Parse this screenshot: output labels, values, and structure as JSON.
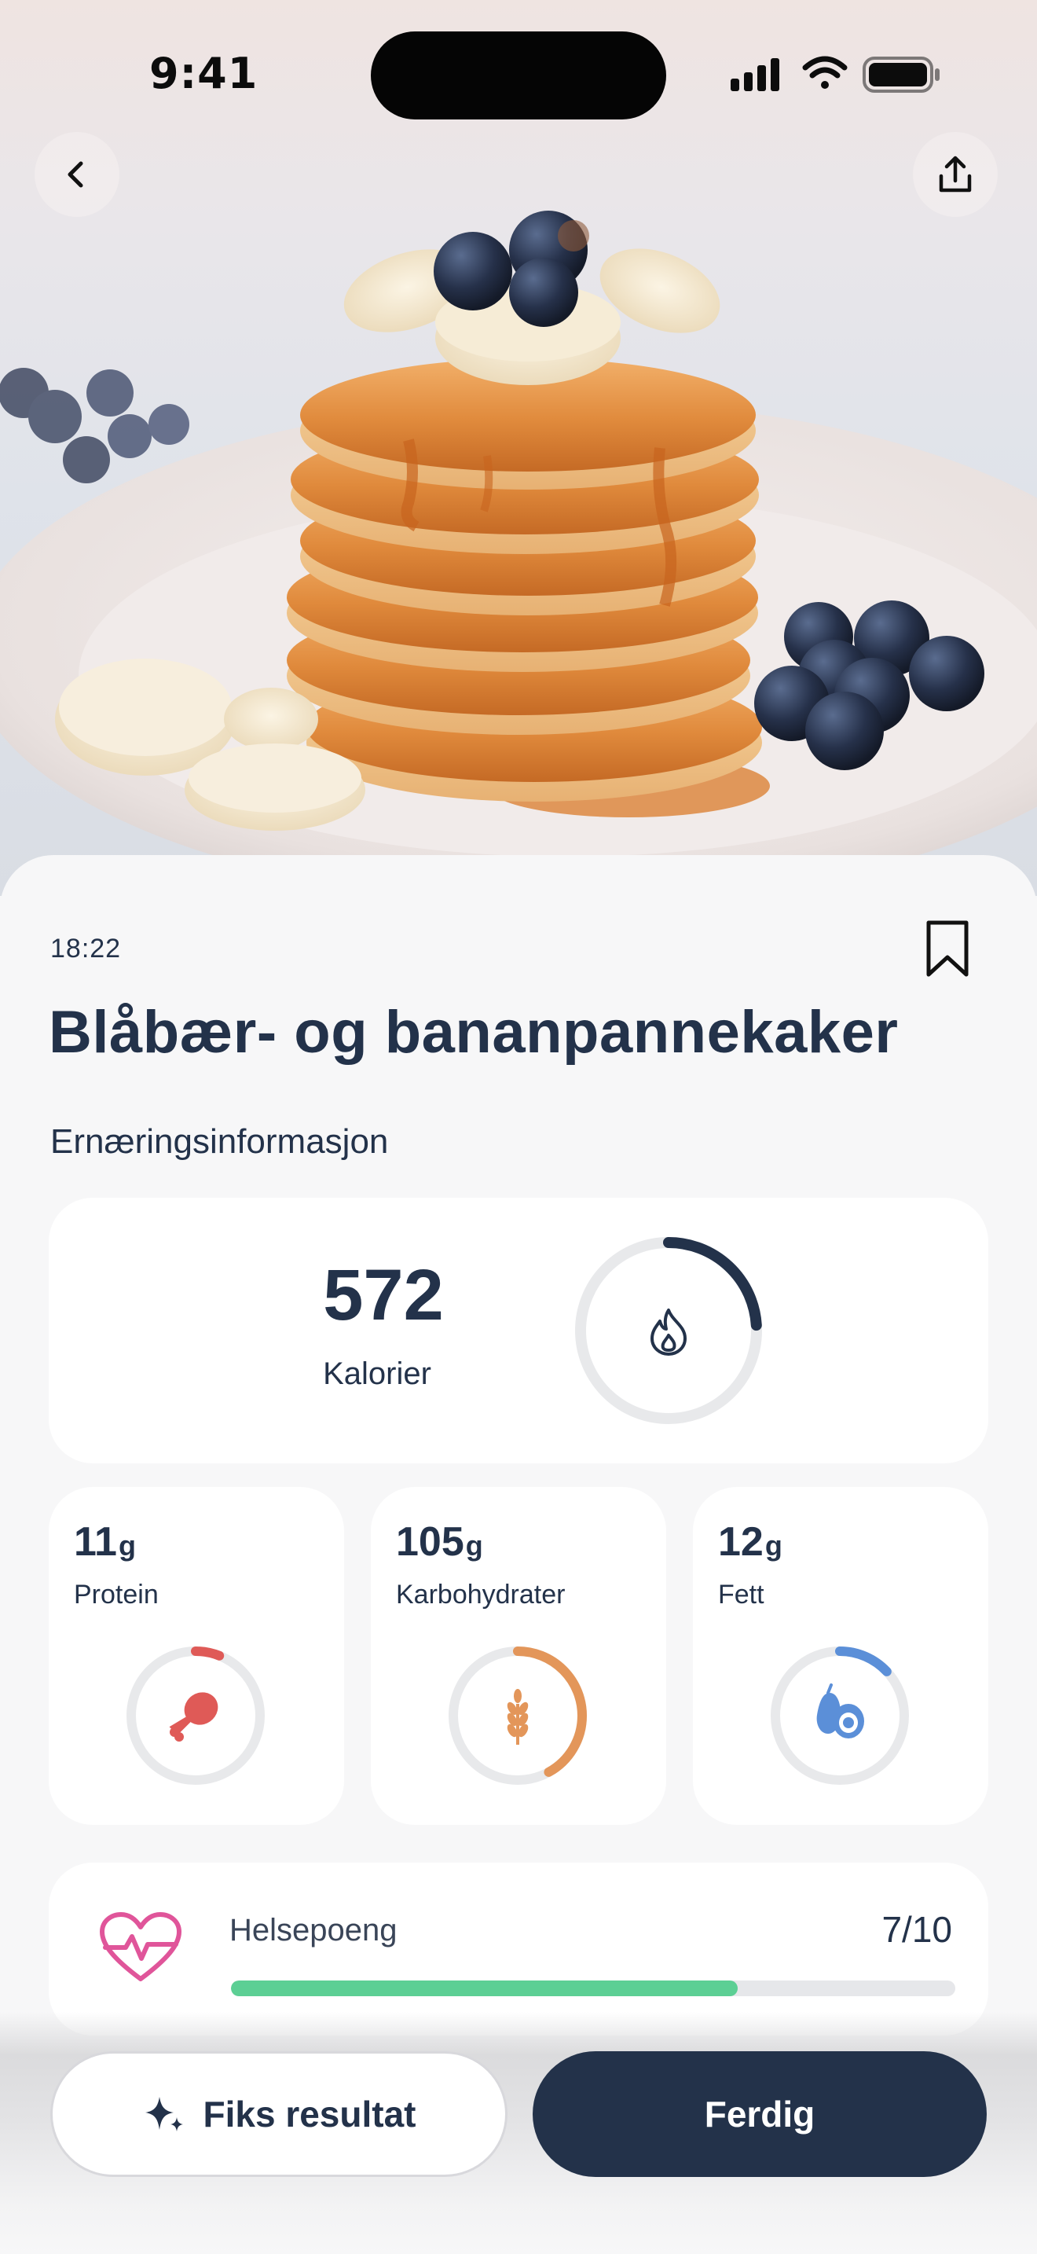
{
  "status_bar": {
    "time": "9:41"
  },
  "meal": {
    "time": "18:22",
    "title": "Blåbær- og bananpannekaker"
  },
  "nutrition": {
    "heading": "Ernæringsinformasjon",
    "calories": {
      "value": "572",
      "label": "Kalorier",
      "progress": 0.24,
      "color": "#23324a",
      "icon": "flame-icon"
    },
    "macros": [
      {
        "key": "protein",
        "value": "11",
        "unit": "g",
        "label": "Protein",
        "progress": 0.06,
        "color": "#df5a57",
        "icon": "drumstick-icon"
      },
      {
        "key": "carbs",
        "value": "105",
        "unit": "g",
        "label": "Karbohydrater",
        "progress": 0.42,
        "color": "#e3965a",
        "icon": "wheat-icon"
      },
      {
        "key": "fat",
        "value": "12",
        "unit": "g",
        "label": "Fett",
        "progress": 0.13,
        "color": "#5b8fd8",
        "icon": "avocado-icon"
      }
    ]
  },
  "health": {
    "label": "Helsepoeng",
    "score": "7/10",
    "progress": 0.7,
    "bar_color": "#5ccf94",
    "icon_color": "#e0559a",
    "icon": "heart-pulse-icon"
  },
  "actions": {
    "fix_label": "Fiks resultat",
    "done_label": "Ferdig"
  },
  "icons": {
    "back": "chevron-left-icon",
    "share": "share-icon",
    "bookmark": "bookmark-icon",
    "sparkle": "sparkle-icon"
  }
}
